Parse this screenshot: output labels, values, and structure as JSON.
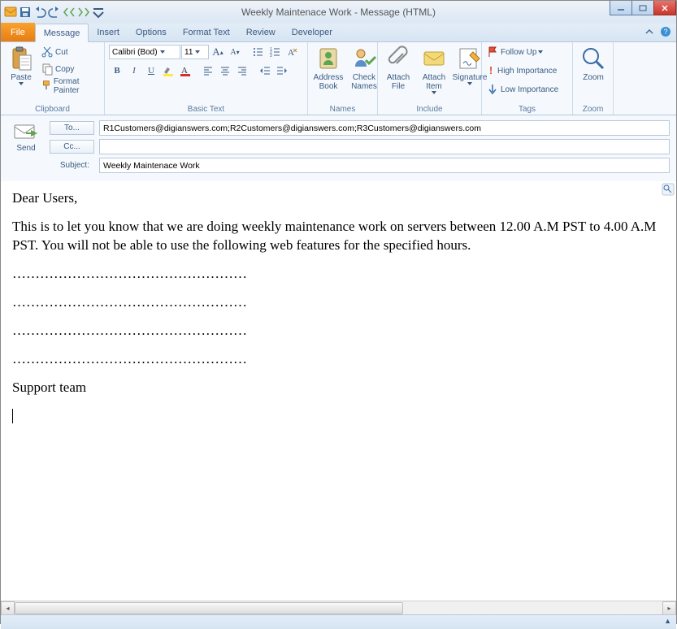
{
  "window": {
    "title": "Weekly Maintenace Work - Message (HTML)"
  },
  "qat_icons": [
    "outlook-icon",
    "save-icon",
    "undo-icon",
    "redo-icon",
    "prev-icon",
    "next-icon"
  ],
  "tabs": {
    "file": "File",
    "items": [
      "Message",
      "Insert",
      "Options",
      "Format Text",
      "Review",
      "Developer"
    ],
    "active": "Message"
  },
  "ribbon": {
    "clipboard": {
      "label": "Clipboard",
      "paste": "Paste",
      "cut": "Cut",
      "copy": "Copy",
      "format_painter": "Format Painter"
    },
    "basic_text": {
      "label": "Basic Text",
      "font": "Calibri (Bod)",
      "size": "11"
    },
    "names": {
      "label": "Names",
      "address_book": "Address\nBook",
      "check_names": "Check\nNames"
    },
    "include": {
      "label": "Include",
      "attach_file": "Attach\nFile",
      "attach_item": "Attach\nItem",
      "signature": "Signature"
    },
    "tags": {
      "label": "Tags",
      "follow_up": "Follow Up",
      "high": "High Importance",
      "low": "Low Importance"
    },
    "zoom": {
      "label": "Zoom",
      "zoom": "Zoom"
    }
  },
  "fields": {
    "send": "Send",
    "to_btn": "To...",
    "cc_btn": "Cc...",
    "subject_label": "Subject:",
    "to_value": "R1Customers@digianswers.com;R2Customers@digianswers.com;R3Customers@digianswers.com",
    "cc_value": "",
    "subject_value": "Weekly Maintenace Work"
  },
  "body": {
    "greeting": "Dear Users,",
    "para1": "This is to let you know that we are doing weekly maintenance work on servers between 12.00 A.M PST to 4.00 A.M PST. You will not be able to use the following web features for the specified hours.",
    "dots": "……………………………………………",
    "signoff": "Support team"
  }
}
